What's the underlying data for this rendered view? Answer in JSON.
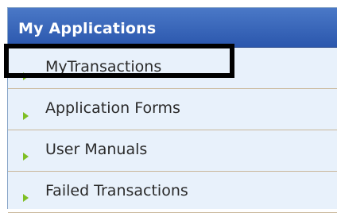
{
  "panel": {
    "title": "My Applications",
    "items": [
      {
        "label": "MyTransactions",
        "icon": "green-arrow-icon",
        "highlighted": true
      },
      {
        "label": "Application Forms",
        "icon": "green-arrow-icon"
      },
      {
        "label": "User Manuals",
        "icon": "green-arrow-icon"
      },
      {
        "label": "Failed Transactions",
        "icon": "green-arrow-icon"
      }
    ]
  },
  "colors": {
    "header": "#2b57ad",
    "background": "#e8f1fb",
    "arrow": "#7fbf24",
    "highlight": "#000000"
  }
}
